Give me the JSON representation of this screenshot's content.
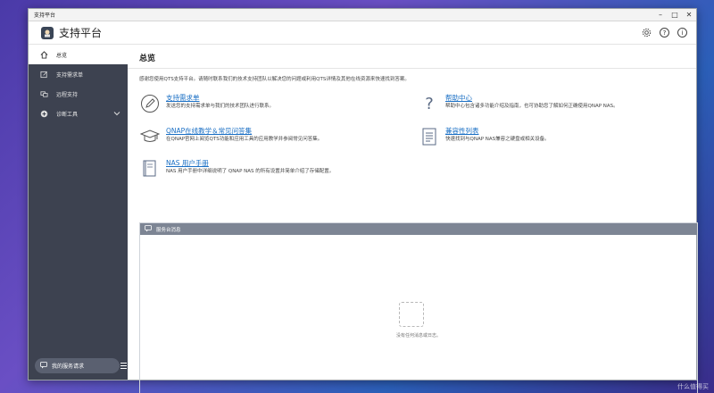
{
  "window": {
    "title": "支持平台"
  },
  "app": {
    "title": "支持平台"
  },
  "sidebar": {
    "items": [
      {
        "label": "总览"
      },
      {
        "label": "支持需求单"
      },
      {
        "label": "远程支持"
      },
      {
        "label": "诊断工具"
      }
    ],
    "bottom_button": "我的服务请求"
  },
  "main": {
    "title": "总览",
    "intro": "感谢您使用QTS支持平台。请随时联系我们的技术支持团队以解决您的问题或利用QTS详情及其他在线资源来快速找到答案。",
    "links": [
      {
        "title": "支持需求单",
        "desc": "发送您的支持需求单与我们的技术团队进行联系。"
      },
      {
        "title": "帮助中心",
        "desc": "帮助中心包含诸多功能介绍及指南，也可协助您了解如何正确使用QNAP NAS。"
      },
      {
        "title": "QNAP在线教学＆常见问答集",
        "desc": "在QNAP官网上阅览QTS功能和应用工具的应用教学并参阅常见问答集。"
      },
      {
        "title": "兼容性列表",
        "desc": "快速找到与QNAP NAS兼容之硬盘或相关设备。"
      },
      {
        "title": "NAS 用户手册",
        "desc": "NAS 用户手册中详细说明了 QNAP NAS 的所有设置并简单介绍了存储配置。"
      }
    ],
    "message_panel": {
      "title": "服务台消息",
      "empty_text": "没有任何消息或日志。"
    }
  },
  "watermark": "什么值得买",
  "icons": [
    "home-icon",
    "ticket-icon",
    "remote-icon",
    "plus-circle-icon",
    "gear-icon",
    "help-icon",
    "info-icon",
    "chat-icon"
  ]
}
